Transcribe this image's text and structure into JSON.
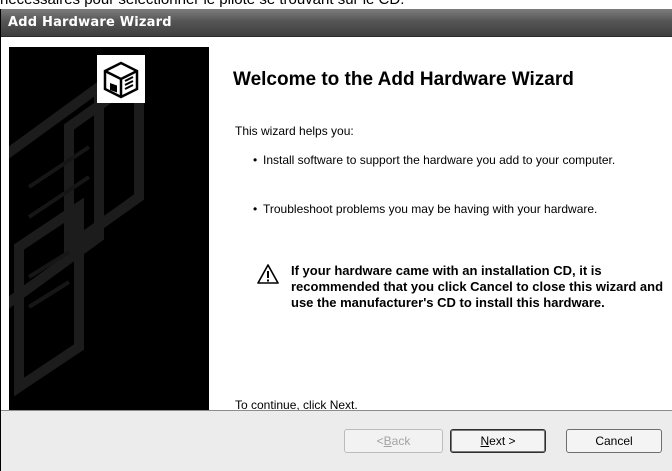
{
  "top_caption": "nécessaires pour sélectionner le pilote se trouvant sur le CD.",
  "window": {
    "title": "Add Hardware Wizard"
  },
  "side_panel": {
    "icon": "hardware-card-icon"
  },
  "content": {
    "heading": "Welcome to the Add Hardware Wizard",
    "intro": "This wizard helps you:",
    "bullets": [
      "Install software to support the hardware you add to your computer.",
      "Troubleshoot problems you may be having with your hardware."
    ],
    "warning_icon": "warning-icon",
    "warning_text": "If your hardware came with an installation CD, it is recommended that you click Cancel to close this wizard and use the manufacturer's CD to install this hardware.",
    "continue_text": "To continue, click Next."
  },
  "footer": {
    "back_label_prefix": "< ",
    "back_label_accel": "B",
    "back_label_rest": "ack",
    "next_label_accel": "N",
    "next_label_rest": "ext >",
    "cancel_label": "Cancel"
  }
}
